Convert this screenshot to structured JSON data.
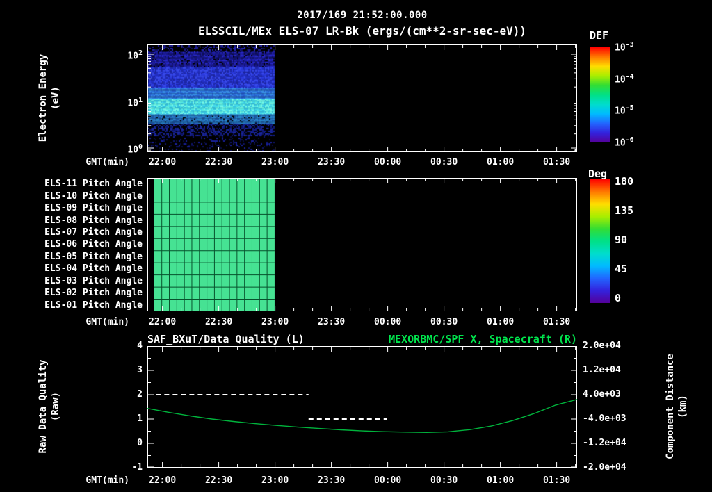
{
  "header": {
    "timestamp": "2017/169 21:52:00.000",
    "instrument_title": "ELSSCIL/MEx ELS-07 LR-Bk (ergs/(cm**2-sr-sec-eV))"
  },
  "x_axis": {
    "label": "GMT(min)",
    "tick_labels": [
      "22:00",
      "22:30",
      "23:00",
      "23:30",
      "00:00",
      "00:30",
      "01:00",
      "01:30"
    ]
  },
  "colors": {
    "background": "#000000",
    "text": "#ffffff",
    "frame": "#ffffff",
    "title_green": "#00e54d",
    "series_green": "#00b33c",
    "quality_line": "#ffffff",
    "pitch_fill": "#46e293",
    "pitch_grid": "#07522d",
    "rainbow": [
      "#ff0000",
      "#ff7700",
      "#ffdd00",
      "#aaee00",
      "#33dd33",
      "#00e087",
      "#00ddcc",
      "#00bbff",
      "#2266ff",
      "#3322dd",
      "#550099"
    ]
  },
  "chart_data": [
    {
      "type": "heatmap",
      "name": "electron-energy-spectrogram",
      "ylabel_lines": [
        "Electron Energy",
        "(eV)"
      ],
      "xlabel": "GMT(min)",
      "y_scale": "log",
      "y_major_exponents": [
        2,
        1,
        0
      ],
      "ylim_exponents": [
        -0.09,
        2.21
      ],
      "colorbar": {
        "title": "DEF",
        "tick_exponents": [
          -3,
          -4,
          -5,
          -6
        ]
      },
      "data_time_fraction": [
        0.0,
        0.296
      ],
      "bands": [
        {
          "exp_range": [
            2.05,
            2.21
          ],
          "density": 0.35,
          "colors": [
            "#1a1a8e",
            "#10105a",
            "#2525b4"
          ]
        },
        {
          "exp_range": [
            1.72,
            2.05
          ],
          "density": 0.92,
          "colors": [
            "#2121b4",
            "#1a1a96",
            "#2a2ad2",
            "#12126a"
          ]
        },
        {
          "exp_range": [
            1.28,
            1.72
          ],
          "density": 1.0,
          "colors": [
            "#2d3ce6",
            "#2430c8",
            "#3a4cf0",
            "#1e28aa"
          ]
        },
        {
          "exp_range": [
            1.05,
            1.28
          ],
          "density": 1.0,
          "colors": [
            "#2e7ae6",
            "#2a64d8",
            "#3c96f0"
          ]
        },
        {
          "exp_range": [
            0.72,
            1.05
          ],
          "density": 1.0,
          "colors": [
            "#5af0e6",
            "#46e0f0",
            "#78fff0",
            "#38c8e6"
          ]
        },
        {
          "exp_range": [
            0.52,
            0.72
          ],
          "density": 0.9,
          "colors": [
            "#2878c8",
            "#1e5aaa",
            "#2a8cd2"
          ]
        },
        {
          "exp_range": [
            0.28,
            0.52
          ],
          "density": 0.55,
          "colors": [
            "#141e8c",
            "#0e1464",
            "#1c28a0"
          ]
        },
        {
          "exp_range": [
            -0.09,
            0.28
          ],
          "density": 0.22,
          "colors": [
            "#10166e",
            "#0a0e46",
            "#1a22a0"
          ]
        }
      ]
    },
    {
      "type": "heatmap",
      "name": "pitch-angle-grid",
      "row_labels": [
        "ELS-11 Pitch Angle",
        "ELS-10 Pitch Angle",
        "ELS-09 Pitch Angle",
        "ELS-08 Pitch Angle",
        "ELS-07 Pitch Angle",
        "ELS-06 Pitch Angle",
        "ELS-05 Pitch Angle",
        "ELS-04 Pitch Angle",
        "ELS-03 Pitch Angle",
        "ELS-02 Pitch Angle",
        "ELS-01 Pitch Angle"
      ],
      "xlabel": "GMT(min)",
      "colorbar": {
        "title": "Deg",
        "ticks": [
          "180",
          "135",
          "90",
          "45",
          "0"
        ]
      },
      "data_time_fraction": [
        0.016,
        0.296
      ],
      "grid_cols": 16,
      "uniform_value_deg": 100
    },
    {
      "type": "line",
      "name": "quality-and-distance",
      "title_left": "SAF_BXuT/Data Quality (L)",
      "title_right": "MEXORBMC/SPF X, Spacecraft (R)",
      "ylabel_left_lines": [
        "Raw Data Quality",
        "(Raw)"
      ],
      "ylabel_right_lines": [
        "Component Distance",
        "(km)"
      ],
      "xlabel": "GMT(min)",
      "ylim_left": [
        -1,
        4
      ],
      "y_ticks_left": [
        "4",
        "3",
        "2",
        "1",
        "0",
        "-1"
      ],
      "ylim_right": [
        -20000,
        20000
      ],
      "y_ticks_right": [
        "2.0e+04",
        "1.2e+04",
        "4.0e+03",
        "-4.0e+03",
        "-1.2e+04",
        "-2.0e+04"
      ],
      "series": [
        {
          "name": "SAF_BXuT/Data Quality",
          "axis": "left",
          "style": "dashed",
          "segments": [
            {
              "value": 2,
              "t": [
                0.02,
                0.375
              ]
            },
            {
              "value": 1,
              "t": [
                0.375,
                0.558
              ]
            }
          ]
        },
        {
          "name": "MEXORBMC/SPF X Spacecraft",
          "axis": "right",
          "style": "solid",
          "points": [
            [
              0.0,
              -500
            ],
            [
              0.05,
              -1800
            ],
            [
              0.1,
              -3000
            ],
            [
              0.15,
              -4000
            ],
            [
              0.2,
              -4800
            ],
            [
              0.25,
              -5500
            ],
            [
              0.3,
              -6100
            ],
            [
              0.35,
              -6650
            ],
            [
              0.4,
              -7100
            ],
            [
              0.45,
              -7550
            ],
            [
              0.5,
              -7900
            ],
            [
              0.55,
              -8150
            ],
            [
              0.6,
              -8300
            ],
            [
              0.65,
              -8400
            ],
            [
              0.7,
              -8200
            ],
            [
              0.75,
              -7500
            ],
            [
              0.8,
              -6300
            ],
            [
              0.85,
              -4500
            ],
            [
              0.9,
              -2200
            ],
            [
              0.95,
              600
            ],
            [
              1.0,
              2450
            ]
          ]
        }
      ]
    }
  ]
}
